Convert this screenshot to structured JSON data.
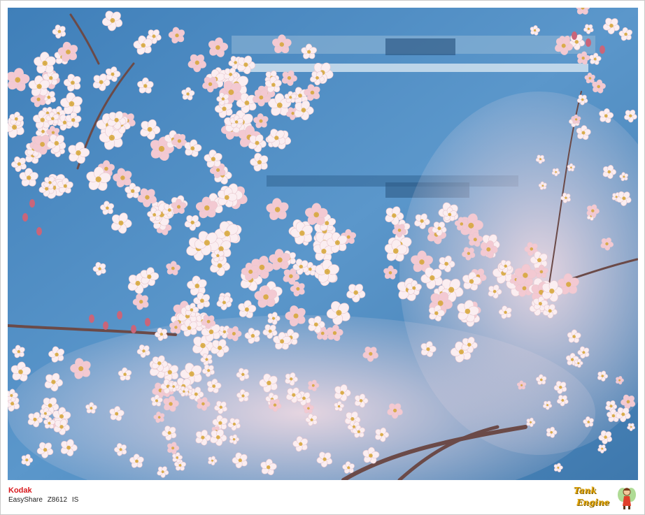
{
  "camera": {
    "brand": "Kodak",
    "model_line": "EasyShare",
    "model_number": "Z8612",
    "model_suffix": "IS"
  },
  "watermark": {
    "line1": "Tank",
    "line2": "Engine",
    "icon": "fairy-mascot-icon"
  },
  "photo": {
    "subject": "cherry-blossom-branches",
    "colors": {
      "sky_glass": "#4f8bc0",
      "petal": "#fbeef1",
      "petal_pink": "#f3c9d2",
      "branch": "#6b4a48",
      "center": "#d6a634"
    }
  }
}
